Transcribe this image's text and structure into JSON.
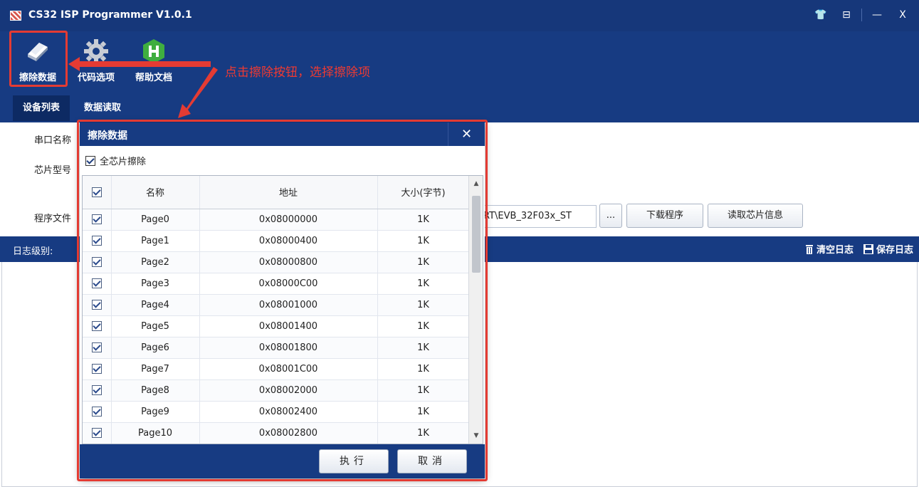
{
  "window": {
    "title": "CS32 ISP Programmer V1.0.1",
    "controls": {
      "skin": "👕",
      "layout": "⊟",
      "minimize": "—",
      "close": "X"
    }
  },
  "toolbar": {
    "erase": "擦除数据",
    "code_options": "代码选项",
    "help": "帮助文档"
  },
  "tabs": {
    "device_list": "设备列表",
    "data_read": "数据读取"
  },
  "form": {
    "serial_label": "串口名称",
    "chip_label": "芯片型号",
    "program_label": "程序文件",
    "program_path": "RT\\EVB_32F03x_ST",
    "browse": "...",
    "download": "下载程序",
    "read_chip": "读取芯片信息"
  },
  "log": {
    "level_label": "日志级别:",
    "clear": "清空日志",
    "save": "保存日志"
  },
  "annotation": {
    "text": "点击擦除按钮，选择擦除项"
  },
  "dialog": {
    "title": "擦除数据",
    "close": "✕",
    "full_chip_erase": "全芯片擦除",
    "columns": {
      "name": "名称",
      "address": "地址",
      "size": "大小(字节)"
    },
    "rows": [
      {
        "name": "Page0",
        "address": "0x08000000",
        "size": "1K"
      },
      {
        "name": "Page1",
        "address": "0x08000400",
        "size": "1K"
      },
      {
        "name": "Page2",
        "address": "0x08000800",
        "size": "1K"
      },
      {
        "name": "Page3",
        "address": "0x08000C00",
        "size": "1K"
      },
      {
        "name": "Page4",
        "address": "0x08001000",
        "size": "1K"
      },
      {
        "name": "Page5",
        "address": "0x08001400",
        "size": "1K"
      },
      {
        "name": "Page6",
        "address": "0x08001800",
        "size": "1K"
      },
      {
        "name": "Page7",
        "address": "0x08001C00",
        "size": "1K"
      },
      {
        "name": "Page8",
        "address": "0x08002000",
        "size": "1K"
      },
      {
        "name": "Page9",
        "address": "0x08002400",
        "size": "1K"
      },
      {
        "name": "Page10",
        "address": "0x08002800",
        "size": "1K"
      }
    ],
    "execute": "执行",
    "cancel": "取消"
  },
  "colors": {
    "primary": "#173b82",
    "annotation": "#e43b33"
  }
}
